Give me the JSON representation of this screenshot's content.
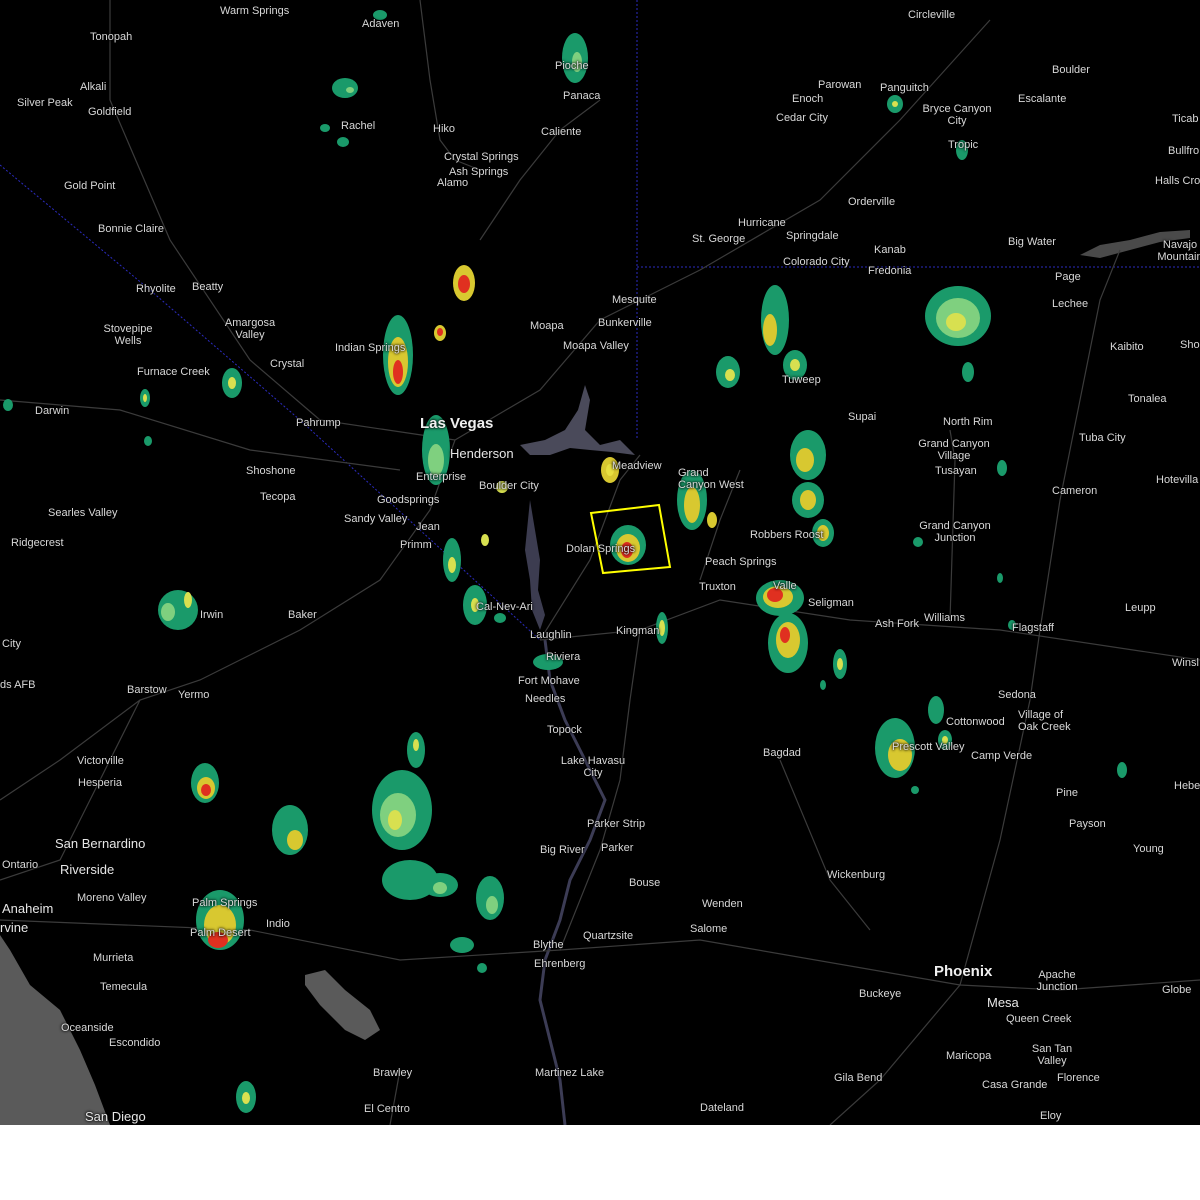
{
  "map": {
    "warning_box_color": "#ffff00",
    "places": [
      {
        "name": "Warm Springs",
        "size": "normal"
      },
      {
        "name": "Adaven",
        "size": "normal"
      },
      {
        "name": "Circleville",
        "size": "normal"
      },
      {
        "name": "Tonopah",
        "size": "normal"
      },
      {
        "name": "Pioche",
        "size": "normal"
      },
      {
        "name": "Parowan",
        "size": "normal"
      },
      {
        "name": "Panguitch",
        "size": "normal"
      },
      {
        "name": "Boulder",
        "size": "normal"
      },
      {
        "name": "Alkali",
        "size": "normal"
      },
      {
        "name": "Panaca",
        "size": "normal"
      },
      {
        "name": "Enoch",
        "size": "normal"
      },
      {
        "name": "Escalante",
        "size": "normal"
      },
      {
        "name": "Silver Peak",
        "size": "normal"
      },
      {
        "name": "Goldfield",
        "size": "normal"
      },
      {
        "name": "Bryce Canyon City",
        "size": "normal"
      },
      {
        "name": "Cedar City",
        "size": "normal"
      },
      {
        "name": "Ticab",
        "size": "normal"
      },
      {
        "name": "Rachel",
        "size": "normal"
      },
      {
        "name": "Hiko",
        "size": "normal"
      },
      {
        "name": "Caliente",
        "size": "normal"
      },
      {
        "name": "Tropic",
        "size": "normal"
      },
      {
        "name": "Bullfro",
        "size": "normal"
      },
      {
        "name": "Crystal Springs",
        "size": "normal"
      },
      {
        "name": "Ash Springs",
        "size": "normal"
      },
      {
        "name": "Halls Cro",
        "size": "normal"
      },
      {
        "name": "Gold Point",
        "size": "normal"
      },
      {
        "name": "Alamo",
        "size": "normal"
      },
      {
        "name": "Orderville",
        "size": "normal"
      },
      {
        "name": "Bonnie Claire",
        "size": "normal"
      },
      {
        "name": "Hurricane",
        "size": "normal"
      },
      {
        "name": "St. George",
        "size": "normal"
      },
      {
        "name": "Springdale",
        "size": "normal"
      },
      {
        "name": "Big Water",
        "size": "normal"
      },
      {
        "name": "Navajo Mountain",
        "size": "normal"
      },
      {
        "name": "Kanab",
        "size": "normal"
      },
      {
        "name": "Colorado City",
        "size": "normal"
      },
      {
        "name": "Fredonia",
        "size": "normal"
      },
      {
        "name": "Page",
        "size": "normal"
      },
      {
        "name": "Rhyolite",
        "size": "normal"
      },
      {
        "name": "Beatty",
        "size": "normal"
      },
      {
        "name": "Mesquite",
        "size": "normal"
      },
      {
        "name": "Lechee",
        "size": "normal"
      },
      {
        "name": "Bunkerville",
        "size": "normal"
      },
      {
        "name": "Amargosa Valley",
        "size": "normal"
      },
      {
        "name": "Moapa",
        "size": "normal"
      },
      {
        "name": "Stovepipe Wells",
        "size": "normal"
      },
      {
        "name": "Kaibito",
        "size": "normal"
      },
      {
        "name": "Sho",
        "size": "normal"
      },
      {
        "name": "Indian Springs",
        "size": "normal"
      },
      {
        "name": "Moapa Valley",
        "size": "normal"
      },
      {
        "name": "Crystal",
        "size": "normal"
      },
      {
        "name": "Furnace Creek",
        "size": "normal"
      },
      {
        "name": "Tuweep",
        "size": "normal"
      },
      {
        "name": "Tonalea",
        "size": "normal"
      },
      {
        "name": "Darwin",
        "size": "normal"
      },
      {
        "name": "Supai",
        "size": "normal"
      },
      {
        "name": "North Rim",
        "size": "normal"
      },
      {
        "name": "Pahrump",
        "size": "normal"
      },
      {
        "name": "Las Vegas",
        "size": "major"
      },
      {
        "name": "Tuba City",
        "size": "normal"
      },
      {
        "name": "Grand Canyon Village",
        "size": "normal"
      },
      {
        "name": "Henderson",
        "size": "big"
      },
      {
        "name": "Meadview",
        "size": "normal"
      },
      {
        "name": "Shoshone",
        "size": "normal"
      },
      {
        "name": "Grand Canyon West",
        "size": "normal"
      },
      {
        "name": "Tusayan",
        "size": "normal"
      },
      {
        "name": "Enterprise",
        "size": "normal"
      },
      {
        "name": "Hotevilla",
        "size": "normal"
      },
      {
        "name": "Boulder City",
        "size": "normal"
      },
      {
        "name": "Cameron",
        "size": "normal"
      },
      {
        "name": "Tecopa",
        "size": "normal"
      },
      {
        "name": "Goodsprings",
        "size": "normal"
      },
      {
        "name": "Searles Valley",
        "size": "normal"
      },
      {
        "name": "Sandy Valley",
        "size": "normal"
      },
      {
        "name": "Jean",
        "size": "normal"
      },
      {
        "name": "Grand Canyon Junction",
        "size": "normal"
      },
      {
        "name": "Robbers Roost",
        "size": "normal"
      },
      {
        "name": "Ridgecrest",
        "size": "normal"
      },
      {
        "name": "Dolan Springs",
        "size": "normal"
      },
      {
        "name": "Primm",
        "size": "normal"
      },
      {
        "name": "Peach Springs",
        "size": "normal"
      },
      {
        "name": "Truxton",
        "size": "normal"
      },
      {
        "name": "Valle",
        "size": "normal"
      },
      {
        "name": "Seligman",
        "size": "normal"
      },
      {
        "name": "Cal-Nev-Ari",
        "size": "normal"
      },
      {
        "name": "Leupp",
        "size": "normal"
      },
      {
        "name": "Irwin",
        "size": "normal"
      },
      {
        "name": "Baker",
        "size": "normal"
      },
      {
        "name": "Ash Fork",
        "size": "normal"
      },
      {
        "name": "Williams",
        "size": "normal"
      },
      {
        "name": "City",
        "size": "normal"
      },
      {
        "name": "Flagstaff",
        "size": "normal"
      },
      {
        "name": "Kingman",
        "size": "normal"
      },
      {
        "name": "Laughlin",
        "size": "normal"
      },
      {
        "name": "Winsl",
        "size": "normal"
      },
      {
        "name": "Riviera",
        "size": "normal"
      },
      {
        "name": "Fort Mohave",
        "size": "normal"
      },
      {
        "name": "ds AFB",
        "size": "normal"
      },
      {
        "name": "Barstow",
        "size": "normal"
      },
      {
        "name": "Yermo",
        "size": "normal"
      },
      {
        "name": "Sedona",
        "size": "normal"
      },
      {
        "name": "Needles",
        "size": "normal"
      },
      {
        "name": "Cottonwood",
        "size": "normal"
      },
      {
        "name": "Village of Oak Creek",
        "size": "normal"
      },
      {
        "name": "Topock",
        "size": "normal"
      },
      {
        "name": "Prescott Valley",
        "size": "normal"
      },
      {
        "name": "Bagdad",
        "size": "normal"
      },
      {
        "name": "Camp Verde",
        "size": "normal"
      },
      {
        "name": "Victorville",
        "size": "normal"
      },
      {
        "name": "Lake Havasu City",
        "size": "normal"
      },
      {
        "name": "Hesperia",
        "size": "normal"
      },
      {
        "name": "Hebe",
        "size": "normal"
      },
      {
        "name": "Pine",
        "size": "normal"
      },
      {
        "name": "Parker Strip",
        "size": "normal"
      },
      {
        "name": "Payson",
        "size": "normal"
      },
      {
        "name": "San Bernardino",
        "size": "big"
      },
      {
        "name": "Big River",
        "size": "normal"
      },
      {
        "name": "Parker",
        "size": "normal"
      },
      {
        "name": "Young",
        "size": "normal"
      },
      {
        "name": "Ontario",
        "size": "normal"
      },
      {
        "name": "Riverside",
        "size": "big"
      },
      {
        "name": "Wickenburg",
        "size": "normal"
      },
      {
        "name": "Bouse",
        "size": "normal"
      },
      {
        "name": "Moreno Valley",
        "size": "normal"
      },
      {
        "name": "Palm Springs",
        "size": "normal"
      },
      {
        "name": "Anaheim",
        "size": "big"
      },
      {
        "name": "Wenden",
        "size": "normal"
      },
      {
        "name": "Indio",
        "size": "normal"
      },
      {
        "name": "rvine",
        "size": "big"
      },
      {
        "name": "Palm Desert",
        "size": "normal"
      },
      {
        "name": "Salome",
        "size": "normal"
      },
      {
        "name": "Quartzsite",
        "size": "normal"
      },
      {
        "name": "Blythe",
        "size": "normal"
      },
      {
        "name": "Murrieta",
        "size": "normal"
      },
      {
        "name": "Phoenix",
        "size": "major"
      },
      {
        "name": "Apache Junction",
        "size": "normal"
      },
      {
        "name": "Ehrenberg",
        "size": "normal"
      },
      {
        "name": "Temecula",
        "size": "normal"
      },
      {
        "name": "Globe",
        "size": "normal"
      },
      {
        "name": "Buckeye",
        "size": "normal"
      },
      {
        "name": "Mesa",
        "size": "big"
      },
      {
        "name": "Queen Creek",
        "size": "normal"
      },
      {
        "name": "Oceanside",
        "size": "normal"
      },
      {
        "name": "Escondido",
        "size": "normal"
      },
      {
        "name": "San Tan Valley",
        "size": "normal"
      },
      {
        "name": "Maricopa",
        "size": "normal"
      },
      {
        "name": "Brawley",
        "size": "normal"
      },
      {
        "name": "Martinez Lake",
        "size": "normal"
      },
      {
        "name": "Gila Bend",
        "size": "normal"
      },
      {
        "name": "Florence",
        "size": "normal"
      },
      {
        "name": "Casa Grande",
        "size": "normal"
      },
      {
        "name": "Dateland",
        "size": "normal"
      },
      {
        "name": "El Centro",
        "size": "normal"
      },
      {
        "name": "San Diego",
        "size": "big"
      },
      {
        "name": "Eloy",
        "size": "normal"
      }
    ]
  }
}
